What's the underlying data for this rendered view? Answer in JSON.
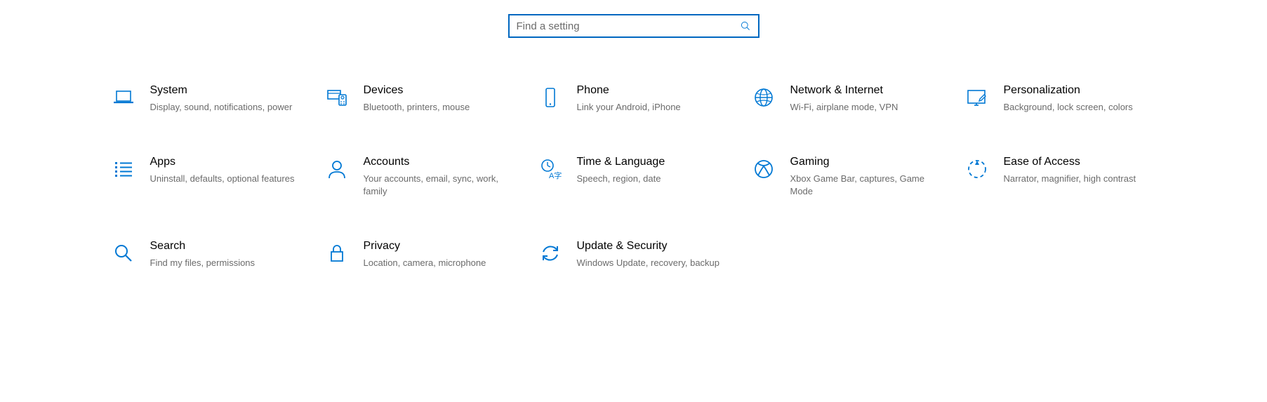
{
  "search": {
    "placeholder": "Find a setting"
  },
  "categories": [
    {
      "id": "system",
      "title": "System",
      "desc": "Display, sound, notifications, power"
    },
    {
      "id": "devices",
      "title": "Devices",
      "desc": "Bluetooth, printers, mouse"
    },
    {
      "id": "phone",
      "title": "Phone",
      "desc": "Link your Android, iPhone"
    },
    {
      "id": "network",
      "title": "Network & Internet",
      "desc": "Wi-Fi, airplane mode, VPN"
    },
    {
      "id": "personalization",
      "title": "Personalization",
      "desc": "Background, lock screen, colors"
    },
    {
      "id": "apps",
      "title": "Apps",
      "desc": "Uninstall, defaults, optional features"
    },
    {
      "id": "accounts",
      "title": "Accounts",
      "desc": "Your accounts, email, sync, work, family"
    },
    {
      "id": "time",
      "title": "Time & Language",
      "desc": "Speech, region, date"
    },
    {
      "id": "gaming",
      "title": "Gaming",
      "desc": "Xbox Game Bar, captures, Game Mode"
    },
    {
      "id": "ease",
      "title": "Ease of Access",
      "desc": "Narrator, magnifier, high contrast"
    },
    {
      "id": "search",
      "title": "Search",
      "desc": "Find my files, permissions"
    },
    {
      "id": "privacy",
      "title": "Privacy",
      "desc": "Location, camera, microphone"
    },
    {
      "id": "update",
      "title": "Update & Security",
      "desc": "Windows Update, recovery, backup"
    }
  ],
  "colors": {
    "accent": "#0067c0",
    "icon": "#0078d4",
    "text_secondary": "#6b6b6b"
  }
}
